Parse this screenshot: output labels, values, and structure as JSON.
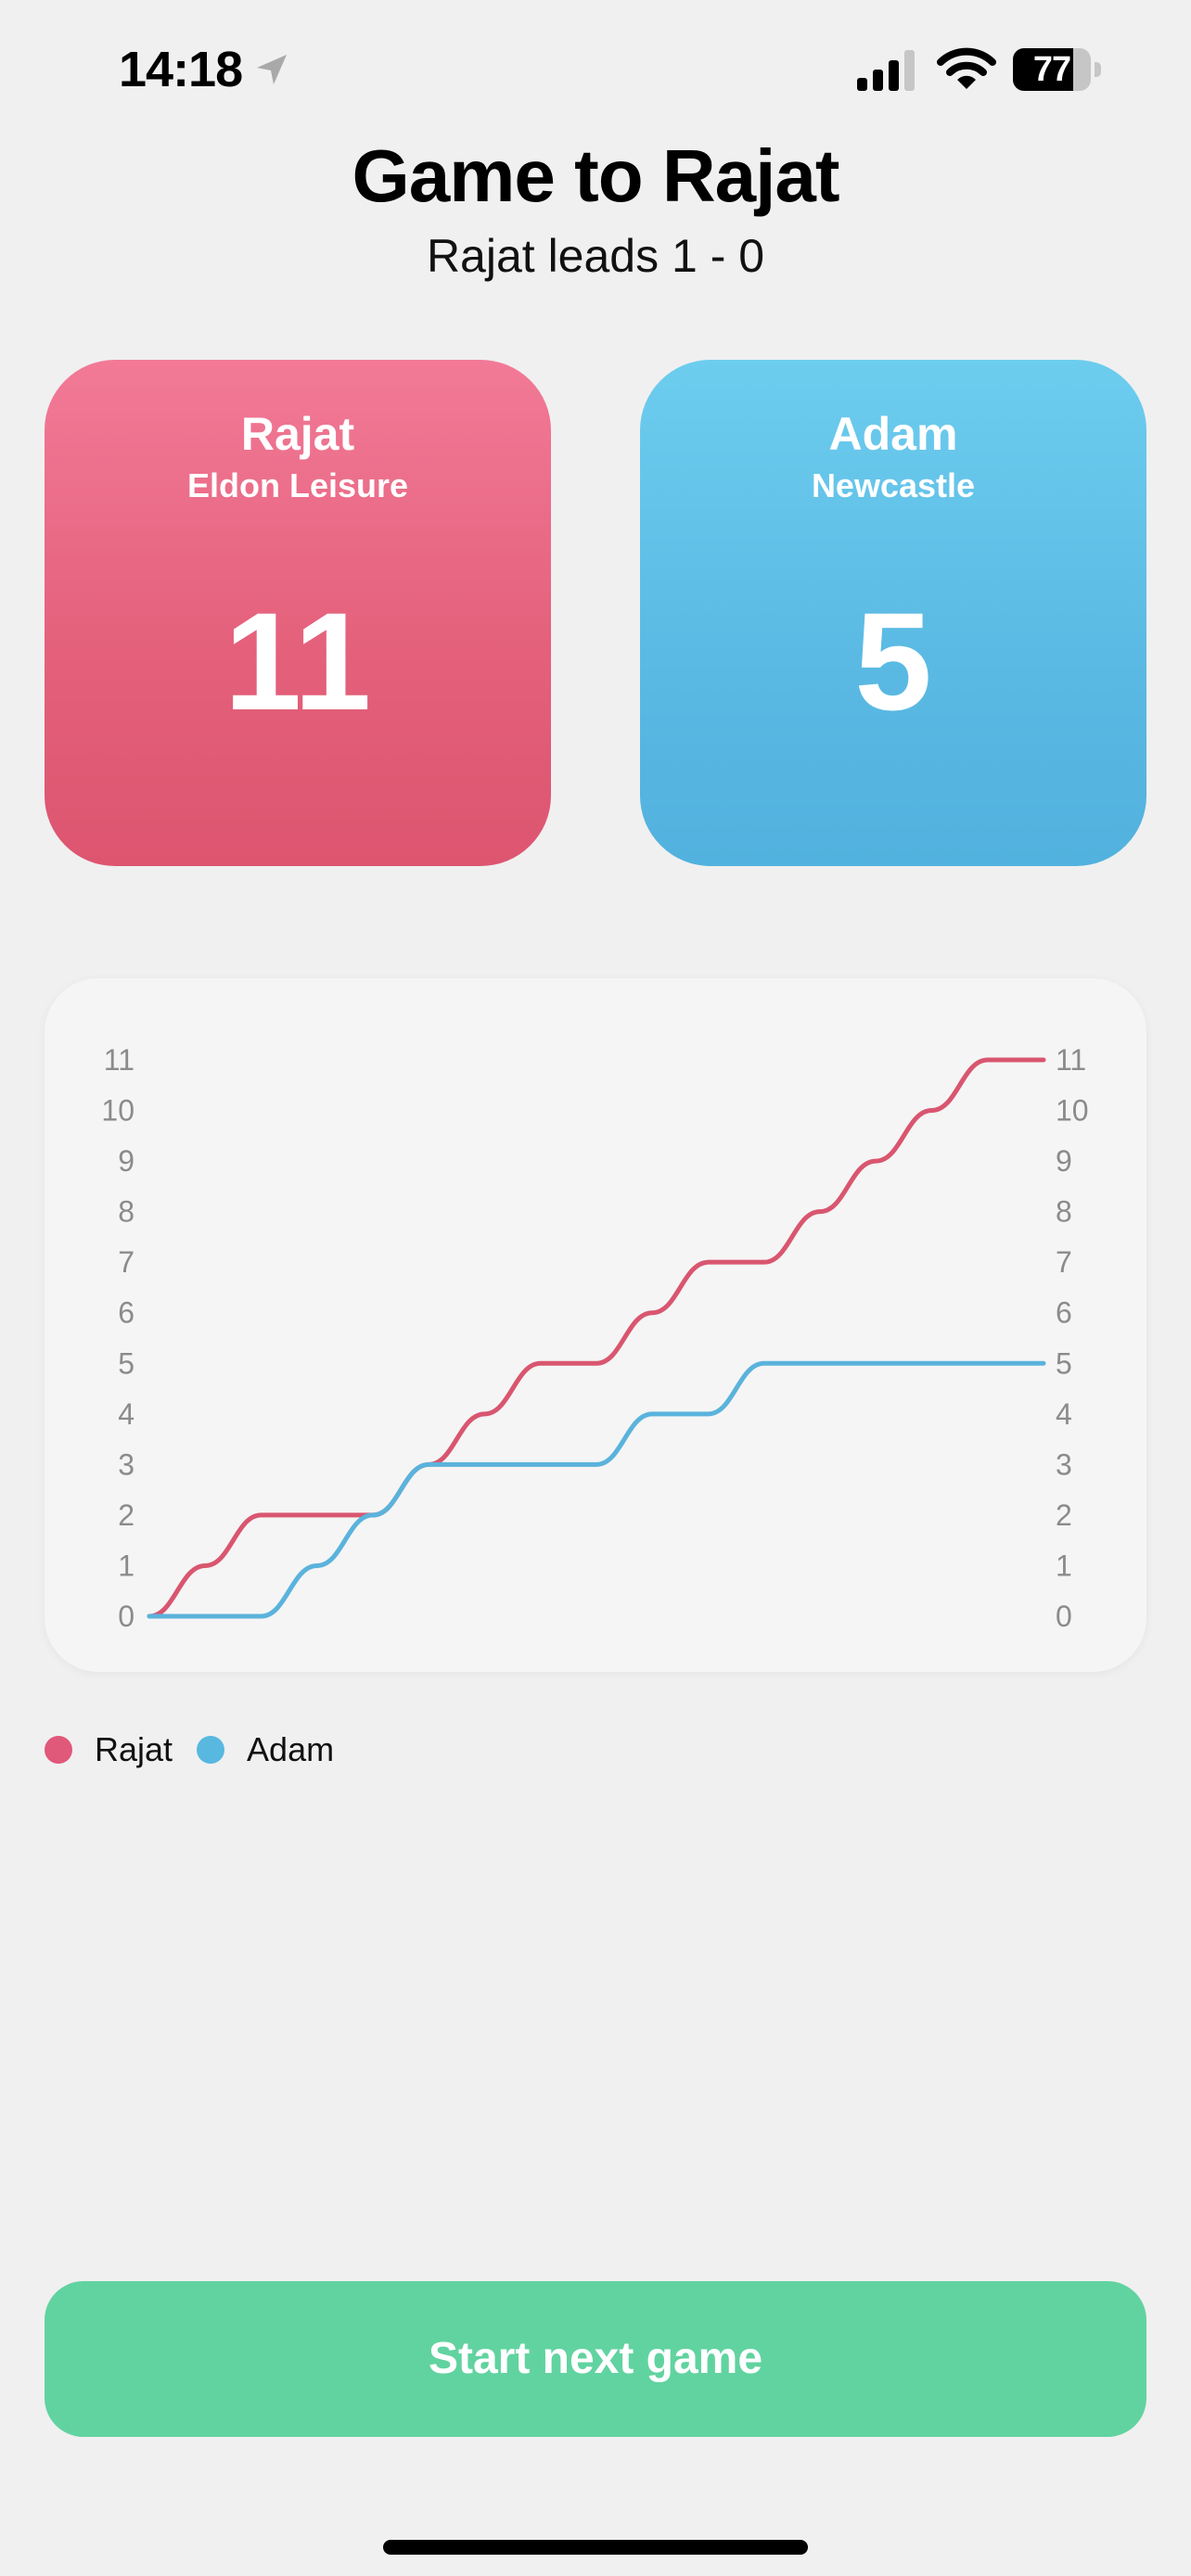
{
  "status_bar": {
    "time": "14:18",
    "battery": "77",
    "battery_level": 0.77,
    "icons": [
      "location-arrow-icon",
      "cellular-signal-icon",
      "wifi-icon",
      "battery-icon"
    ]
  },
  "header": {
    "title": "Game to Rajat",
    "subtitle": "Rajat leads 1 - 0"
  },
  "players": [
    {
      "name": "Rajat",
      "club": "Eldon Leisure",
      "score": "11",
      "color": "#e0587a"
    },
    {
      "name": "Adam",
      "club": "Newcastle",
      "score": "5",
      "color": "#58b8e0"
    }
  ],
  "chart_data": {
    "type": "line",
    "y_ticks": [
      "0",
      "1",
      "2",
      "3",
      "4",
      "5",
      "6",
      "7",
      "8",
      "9",
      "10",
      "11"
    ],
    "ylim": [
      0,
      11
    ],
    "x": [
      0,
      1,
      2,
      3,
      4,
      5,
      6,
      7,
      8,
      9,
      10,
      11,
      12,
      13,
      14,
      15,
      16
    ],
    "series": [
      {
        "name": "Rajat",
        "color": "#d9566f",
        "values": [
          0,
          1,
          2,
          2,
          2,
          3,
          4,
          5,
          5,
          6,
          7,
          7,
          8,
          9,
          10,
          11,
          11
        ]
      },
      {
        "name": "Adam",
        "color": "#5ab3dc",
        "values": [
          0,
          0,
          0,
          1,
          2,
          3,
          3,
          3,
          3,
          4,
          4,
          5,
          5,
          5,
          5,
          5,
          5
        ]
      }
    ],
    "legend": "bottom-left",
    "grid": false
  },
  "legend": [
    {
      "label": "Rajat",
      "color": "#e0587a"
    },
    {
      "label": "Adam",
      "color": "#58b8e0"
    }
  ],
  "actions": {
    "start_next_game": "Start next game"
  }
}
